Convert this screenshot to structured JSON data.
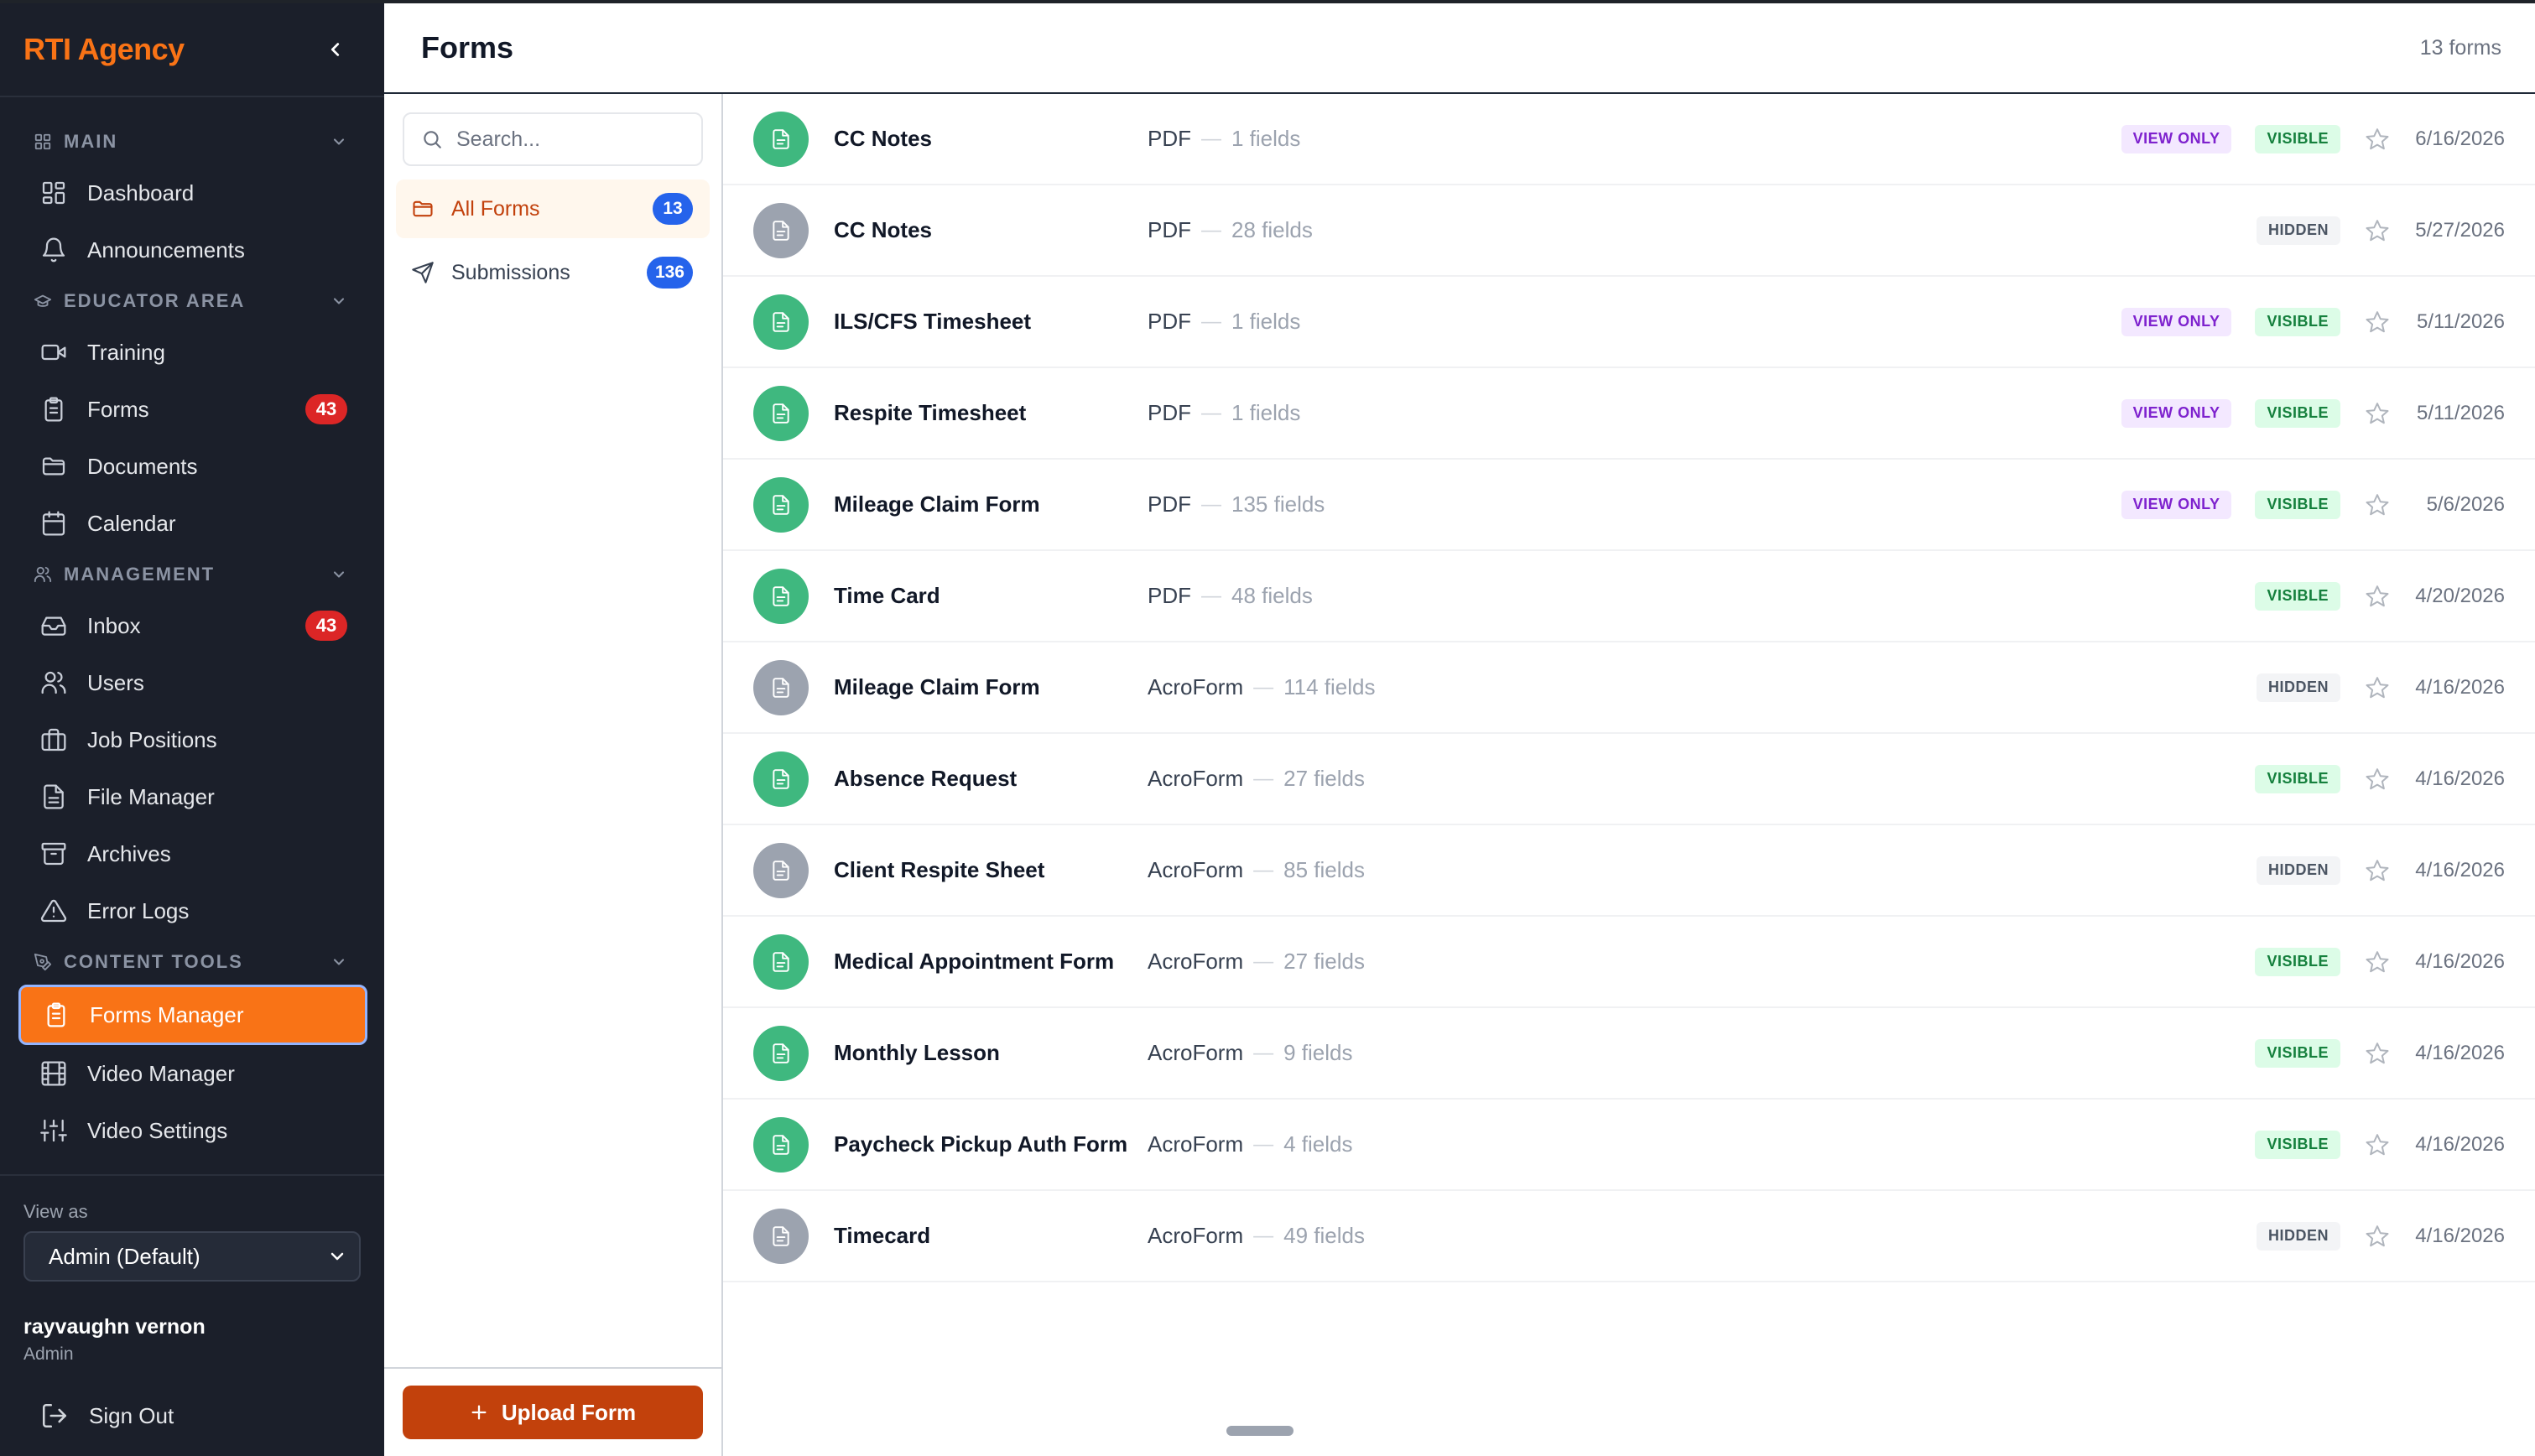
{
  "brand": "RTI Agency",
  "sidebar": {
    "sections": [
      {
        "title": "MAIN",
        "icon": "grid-icon",
        "items": [
          {
            "label": "Dashboard",
            "icon": "dashboard-icon"
          },
          {
            "label": "Announcements",
            "icon": "bell-icon"
          }
        ]
      },
      {
        "title": "EDUCATOR AREA",
        "icon": "graduation-cap-icon",
        "items": [
          {
            "label": "Training",
            "icon": "video-camera-icon"
          },
          {
            "label": "Forms",
            "icon": "clipboard-icon",
            "badge": "43"
          },
          {
            "label": "Documents",
            "icon": "folder-icon"
          },
          {
            "label": "Calendar",
            "icon": "calendar-icon"
          }
        ]
      },
      {
        "title": "MANAGEMENT",
        "icon": "users-icon",
        "items": [
          {
            "label": "Inbox",
            "icon": "inbox-icon",
            "badge": "43"
          },
          {
            "label": "Users",
            "icon": "users-icon"
          },
          {
            "label": "Job Positions",
            "icon": "briefcase-icon"
          },
          {
            "label": "File Manager",
            "icon": "file-icon"
          },
          {
            "label": "Archives",
            "icon": "archive-icon"
          },
          {
            "label": "Error Logs",
            "icon": "warning-icon"
          }
        ]
      },
      {
        "title": "CONTENT TOOLS",
        "icon": "pen-tool-icon",
        "items": [
          {
            "label": "Forms Manager",
            "icon": "clipboard-icon",
            "active": true
          },
          {
            "label": "Video Manager",
            "icon": "film-icon"
          },
          {
            "label": "Video Settings",
            "icon": "sliders-icon"
          }
        ]
      }
    ],
    "view_as_label": "View as",
    "view_as_value": "Admin (Default)",
    "user_name": "rayvaughn vernon",
    "user_role": "Admin",
    "sign_out": "Sign Out"
  },
  "header": {
    "title": "Forms",
    "count": "13 forms"
  },
  "folders": {
    "search_placeholder": "Search...",
    "items": [
      {
        "label": "All Forms",
        "count": "13",
        "icon": "folder-icon",
        "active": true
      },
      {
        "label": "Submissions",
        "count": "136",
        "icon": "send-icon"
      }
    ],
    "upload_label": "Upload Form"
  },
  "forms": [
    {
      "name": "CC Notes",
      "type": "PDF",
      "fields": "1 fields",
      "view_only": "VIEW ONLY",
      "status": "VISIBLE",
      "date": "6/16/2026"
    },
    {
      "name": "CC Notes",
      "type": "PDF",
      "fields": "28 fields",
      "view_only": "",
      "status": "HIDDEN",
      "date": "5/27/2026"
    },
    {
      "name": "ILS/CFS Timesheet",
      "type": "PDF",
      "fields": "1 fields",
      "view_only": "VIEW ONLY",
      "status": "VISIBLE",
      "date": "5/11/2026"
    },
    {
      "name": "Respite Timesheet",
      "type": "PDF",
      "fields": "1 fields",
      "view_only": "VIEW ONLY",
      "status": "VISIBLE",
      "date": "5/11/2026"
    },
    {
      "name": "Mileage Claim Form",
      "type": "PDF",
      "fields": "135 fields",
      "view_only": "VIEW ONLY",
      "status": "VISIBLE",
      "date": "5/6/2026"
    },
    {
      "name": "Time Card",
      "type": "PDF",
      "fields": "48 fields",
      "view_only": "",
      "status": "VISIBLE",
      "date": "4/20/2026"
    },
    {
      "name": "Mileage Claim Form",
      "type": "AcroForm",
      "fields": "114 fields",
      "view_only": "",
      "status": "HIDDEN",
      "date": "4/16/2026"
    },
    {
      "name": "Absence Request",
      "type": "AcroForm",
      "fields": "27 fields",
      "view_only": "",
      "status": "VISIBLE",
      "date": "4/16/2026"
    },
    {
      "name": "Client Respite Sheet",
      "type": "AcroForm",
      "fields": "85 fields",
      "view_only": "",
      "status": "HIDDEN",
      "date": "4/16/2026"
    },
    {
      "name": "Medical Appointment Form",
      "type": "AcroForm",
      "fields": "27 fields",
      "view_only": "",
      "status": "VISIBLE",
      "date": "4/16/2026"
    },
    {
      "name": "Monthly Lesson",
      "type": "AcroForm",
      "fields": "9 fields",
      "view_only": "",
      "status": "VISIBLE",
      "date": "4/16/2026"
    },
    {
      "name": "Paycheck Pickup Auth Form",
      "type": "AcroForm",
      "fields": "4 fields",
      "view_only": "",
      "status": "VISIBLE",
      "date": "4/16/2026"
    },
    {
      "name": "Timecard",
      "type": "AcroForm",
      "fields": "49 fields",
      "view_only": "",
      "status": "HIDDEN",
      "date": "4/16/2026"
    }
  ],
  "separator": "—",
  "colors": {
    "accent": "#f97316",
    "sidebar_bg": "#1b1f2a",
    "visible_green": "#3fb87f",
    "hidden_gray": "#9ca3af",
    "badge_blue": "#2563eb",
    "badge_red": "#dc2626"
  }
}
